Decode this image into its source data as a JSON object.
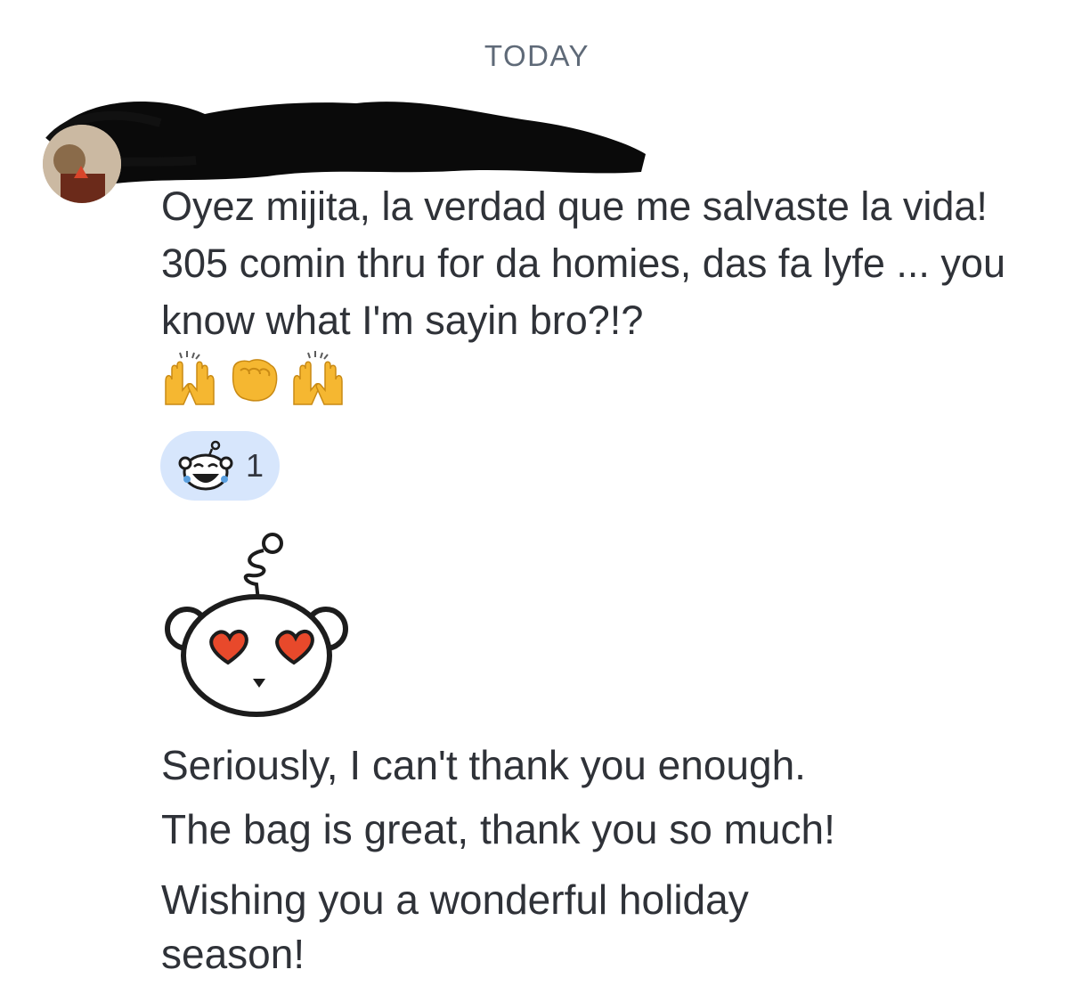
{
  "date_divider": "TODAY",
  "message": {
    "text": "Oyez mijita, la verdad que me salvaste la vida! 305 comin thru for da homies, das fa lyfe ... you know what I'm sayin bro?!?",
    "emojis": [
      "raising-hands-icon",
      "fist-icon",
      "raising-hands-icon"
    ],
    "reaction": {
      "icon": "tears-of-joy-snoo-icon",
      "count": "1"
    }
  },
  "sticker": {
    "icon": "heart-eyes-snoo-icon"
  },
  "followups": [
    "Seriously, I can't thank you enough.",
    "The bag is great, thank you so much!",
    "Wishing you a wonderful holiday",
    "season!"
  ],
  "colors": {
    "reaction_pill": "#d7e6fc",
    "text": "#2f3238",
    "divider": "#5f6a78",
    "heart": "#e8492b"
  }
}
